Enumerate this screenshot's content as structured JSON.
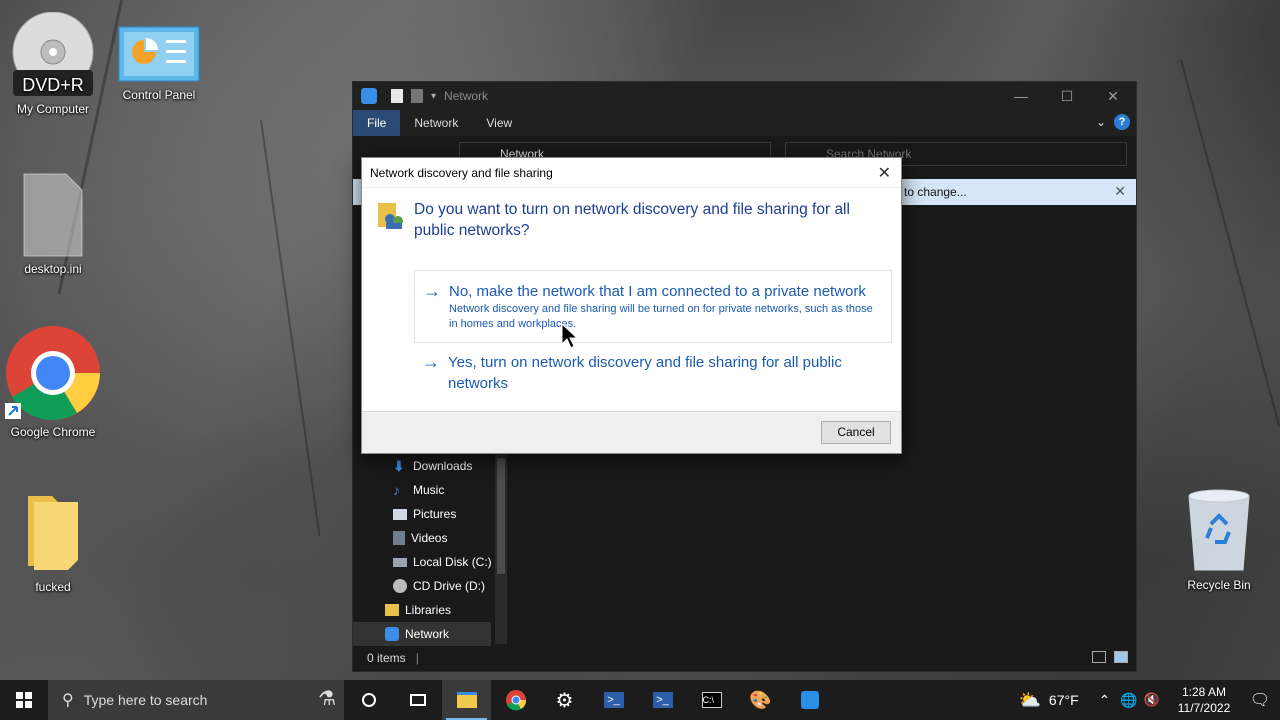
{
  "desktop": {
    "icons": [
      {
        "label": "My Computer",
        "badge": "DVD+R",
        "icon": "dvd-drive-icon"
      },
      {
        "label": "Control Panel",
        "icon": "control-panel-icon"
      },
      {
        "label": "desktop.ini",
        "icon": "file-icon"
      },
      {
        "label": "Google Chrome",
        "icon": "chrome-icon"
      },
      {
        "label": "fucked",
        "icon": "folder-icon"
      },
      {
        "label": "Recycle Bin",
        "icon": "recycle-bin-icon"
      }
    ]
  },
  "explorer": {
    "title": "Network",
    "ribbon_tabs": [
      "File",
      "Network",
      "View"
    ],
    "address": "Network",
    "search_placeholder": "Search Network",
    "infobar_text": "to change...",
    "nav_items": [
      {
        "label": "Downloads",
        "icon": "download-arrow-icon"
      },
      {
        "label": "Music",
        "icon": "music-note-icon"
      },
      {
        "label": "Pictures",
        "icon": "pictures-icon"
      },
      {
        "label": "Videos",
        "icon": "videos-icon"
      },
      {
        "label": "Local Disk (C:)",
        "icon": "local-disk-icon"
      },
      {
        "label": "CD Drive (D:)",
        "icon": "cd-drive-icon"
      },
      {
        "label": "Libraries",
        "icon": "libraries-icon"
      },
      {
        "label": "Network",
        "icon": "network-icon",
        "selected": true
      }
    ],
    "status": "0 items"
  },
  "dialog": {
    "title": "Network discovery and file sharing",
    "question": "Do you want to turn on network discovery and file sharing for all public networks?",
    "option1": {
      "main": "No, make the network that I am connected to a private network",
      "sub": "Network discovery and file sharing will be turned on for private networks, such as those in homes and workplaces."
    },
    "option2": {
      "main": "Yes, turn on network discovery and file sharing for all public networks"
    },
    "cancel": "Cancel"
  },
  "taskbar": {
    "search_placeholder": "Type here to search",
    "temperature": "67°F",
    "time": "1:28 AM",
    "date": "11/7/2022"
  }
}
